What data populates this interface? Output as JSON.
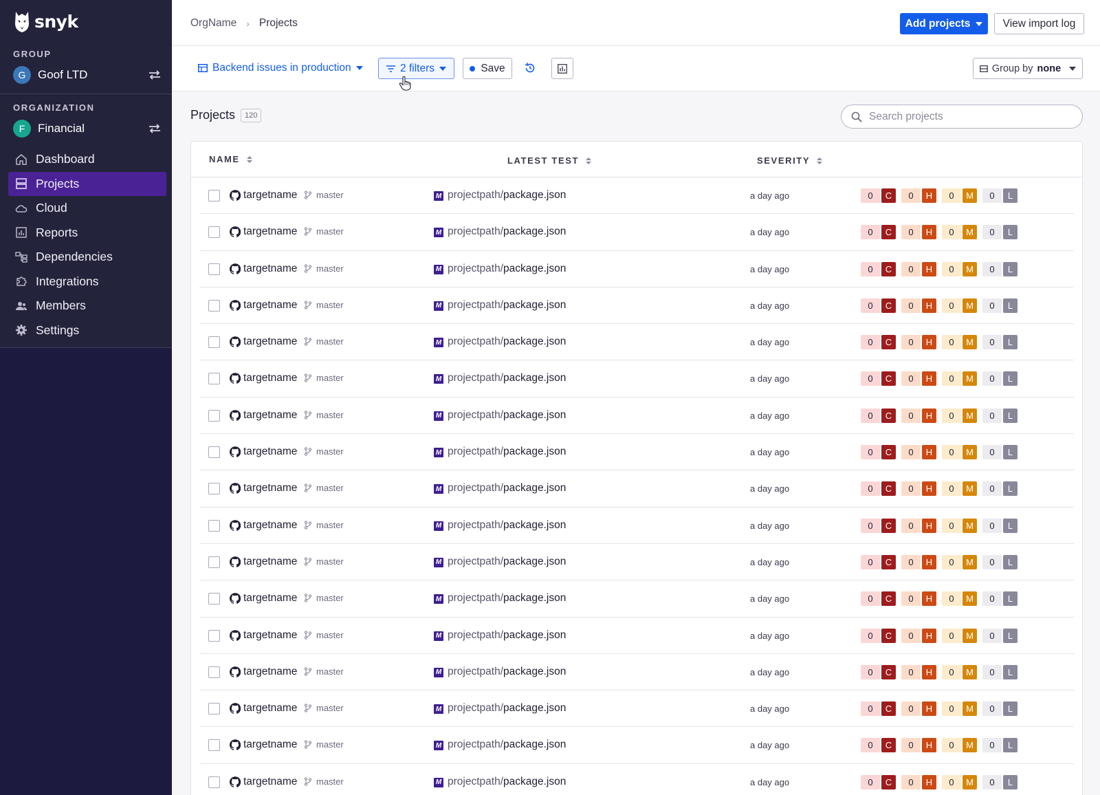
{
  "brand": {
    "name": "snyk"
  },
  "sidebar": {
    "group_label": "GROUP",
    "group_name": "Goof LTD",
    "group_initial": "G",
    "org_label": "ORGANIZATION",
    "org_name": "Financial",
    "org_initial": "F",
    "items": [
      {
        "label": "Dashboard",
        "icon": "home-icon"
      },
      {
        "label": "Projects",
        "icon": "projects-icon",
        "active": true
      },
      {
        "label": "Cloud",
        "icon": "cloud-icon"
      },
      {
        "label": "Reports",
        "icon": "reports-icon"
      },
      {
        "label": "Dependencies",
        "icon": "dependencies-icon"
      },
      {
        "label": "Integrations",
        "icon": "puzzle-icon"
      },
      {
        "label": "Members",
        "icon": "members-icon"
      },
      {
        "label": "Settings",
        "icon": "gear-icon"
      }
    ]
  },
  "header": {
    "breadcrumb": [
      "OrgName",
      "Projects"
    ],
    "add_projects": "Add projects",
    "view_import_log": "View import log"
  },
  "toolbar": {
    "view_name": "Backend issues in production",
    "filters_label": "2 filters",
    "save_label": "Save",
    "group_by_prefix": "Group by",
    "group_by_value": "none"
  },
  "projects": {
    "title": "Projects",
    "count": "120",
    "search_placeholder": "Search projects",
    "columns": {
      "name": "NAME",
      "latest_test": "LATEST TEST",
      "severity": "SEVERITY"
    },
    "rows": [
      {
        "target": "targetname",
        "branch": "master",
        "path_dir": "projectpath/",
        "path_file": "package.json",
        "tested": "a day ago",
        "c": "0",
        "h": "0",
        "m": "0",
        "l": "0"
      },
      {
        "target": "targetname",
        "branch": "master",
        "path_dir": "projectpath/",
        "path_file": "package.json",
        "tested": "a day ago",
        "c": "0",
        "h": "0",
        "m": "0",
        "l": "0"
      },
      {
        "target": "targetname",
        "branch": "master",
        "path_dir": "projectpath/",
        "path_file": "package.json",
        "tested": "a day ago",
        "c": "0",
        "h": "0",
        "m": "0",
        "l": "0"
      },
      {
        "target": "targetname",
        "branch": "master",
        "path_dir": "projectpath/",
        "path_file": "package.json",
        "tested": "a day ago",
        "c": "0",
        "h": "0",
        "m": "0",
        "l": "0"
      },
      {
        "target": "targetname",
        "branch": "master",
        "path_dir": "projectpath/",
        "path_file": "package.json",
        "tested": "a day ago",
        "c": "0",
        "h": "0",
        "m": "0",
        "l": "0"
      },
      {
        "target": "targetname",
        "branch": "master",
        "path_dir": "projectpath/",
        "path_file": "package.json",
        "tested": "a day ago",
        "c": "0",
        "h": "0",
        "m": "0",
        "l": "0"
      },
      {
        "target": "targetname",
        "branch": "master",
        "path_dir": "projectpath/",
        "path_file": "package.json",
        "tested": "a day ago",
        "c": "0",
        "h": "0",
        "m": "0",
        "l": "0"
      },
      {
        "target": "targetname",
        "branch": "master",
        "path_dir": "projectpath/",
        "path_file": "package.json",
        "tested": "a day ago",
        "c": "0",
        "h": "0",
        "m": "0",
        "l": "0"
      },
      {
        "target": "targetname",
        "branch": "master",
        "path_dir": "projectpath/",
        "path_file": "package.json",
        "tested": "a day ago",
        "c": "0",
        "h": "0",
        "m": "0",
        "l": "0"
      },
      {
        "target": "targetname",
        "branch": "master",
        "path_dir": "projectpath/",
        "path_file": "package.json",
        "tested": "a day ago",
        "c": "0",
        "h": "0",
        "m": "0",
        "l": "0"
      },
      {
        "target": "targetname",
        "branch": "master",
        "path_dir": "projectpath/",
        "path_file": "package.json",
        "tested": "a day ago",
        "c": "0",
        "h": "0",
        "m": "0",
        "l": "0"
      },
      {
        "target": "targetname",
        "branch": "master",
        "path_dir": "projectpath/",
        "path_file": "package.json",
        "tested": "a day ago",
        "c": "0",
        "h": "0",
        "m": "0",
        "l": "0"
      },
      {
        "target": "targetname",
        "branch": "master",
        "path_dir": "projectpath/",
        "path_file": "package.json",
        "tested": "a day ago",
        "c": "0",
        "h": "0",
        "m": "0",
        "l": "0"
      },
      {
        "target": "targetname",
        "branch": "master",
        "path_dir": "projectpath/",
        "path_file": "package.json",
        "tested": "a day ago",
        "c": "0",
        "h": "0",
        "m": "0",
        "l": "0"
      },
      {
        "target": "targetname",
        "branch": "master",
        "path_dir": "projectpath/",
        "path_file": "package.json",
        "tested": "a day ago",
        "c": "0",
        "h": "0",
        "m": "0",
        "l": "0"
      },
      {
        "target": "targetname",
        "branch": "master",
        "path_dir": "projectpath/",
        "path_file": "package.json",
        "tested": "a day ago",
        "c": "0",
        "h": "0",
        "m": "0",
        "l": "0"
      },
      {
        "target": "targetname",
        "branch": "master",
        "path_dir": "projectpath/",
        "path_file": "package.json",
        "tested": "a day ago",
        "c": "0",
        "h": "0",
        "m": "0",
        "l": "0"
      }
    ]
  },
  "severity_letters": {
    "c": "C",
    "h": "H",
    "m": "M",
    "l": "L"
  },
  "colors": {
    "sidebar_bg": "#1c1a3f",
    "active_nav": "#4b2296",
    "primary": "#145deb",
    "critical": "#9e1c1c",
    "critical_bg": "#fbd6d6",
    "high": "#cc4a14",
    "high_bg": "#fcdcc9",
    "medium": "#d6870a",
    "medium_bg": "#fdebcb",
    "low": "#88889a",
    "low_bg": "#ececf0"
  }
}
